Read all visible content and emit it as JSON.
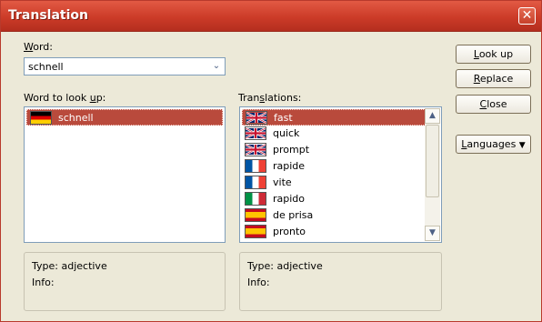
{
  "window": {
    "title": "Translation",
    "close_glyph": "✕"
  },
  "word": {
    "label": "Word:",
    "label_key": "W",
    "label_rest": "ord:",
    "value": "schnell"
  },
  "lookup_list": {
    "label_pre": "Word to look ",
    "label_key": "u",
    "label_post": "p:",
    "items": [
      {
        "text": "schnell",
        "flag": "de",
        "selected": true
      }
    ]
  },
  "translations": {
    "label_pre": "Tran",
    "label_key": "s",
    "label_post": "lations:",
    "items": [
      {
        "text": "fast",
        "flag": "gb",
        "selected": true
      },
      {
        "text": "quick",
        "flag": "gb"
      },
      {
        "text": "prompt",
        "flag": "gb"
      },
      {
        "text": "rapide",
        "flag": "fr"
      },
      {
        "text": "vite",
        "flag": "fr"
      },
      {
        "text": "rapido",
        "flag": "it"
      },
      {
        "text": "de prisa",
        "flag": "es"
      },
      {
        "text": "pronto",
        "flag": "es"
      }
    ]
  },
  "left_info": {
    "type": "Type: adjective",
    "info": "Info:"
  },
  "right_info": {
    "type": "Type: adjective",
    "info": "Info:"
  },
  "buttons": {
    "lookup": {
      "key": "L",
      "rest": "ook up"
    },
    "replace": {
      "key": "R",
      "rest": "eplace"
    },
    "close": {
      "key": "C",
      "rest": "lose"
    },
    "languages": {
      "key": "L",
      "rest": "anguages",
      "arrow": "▼"
    }
  }
}
